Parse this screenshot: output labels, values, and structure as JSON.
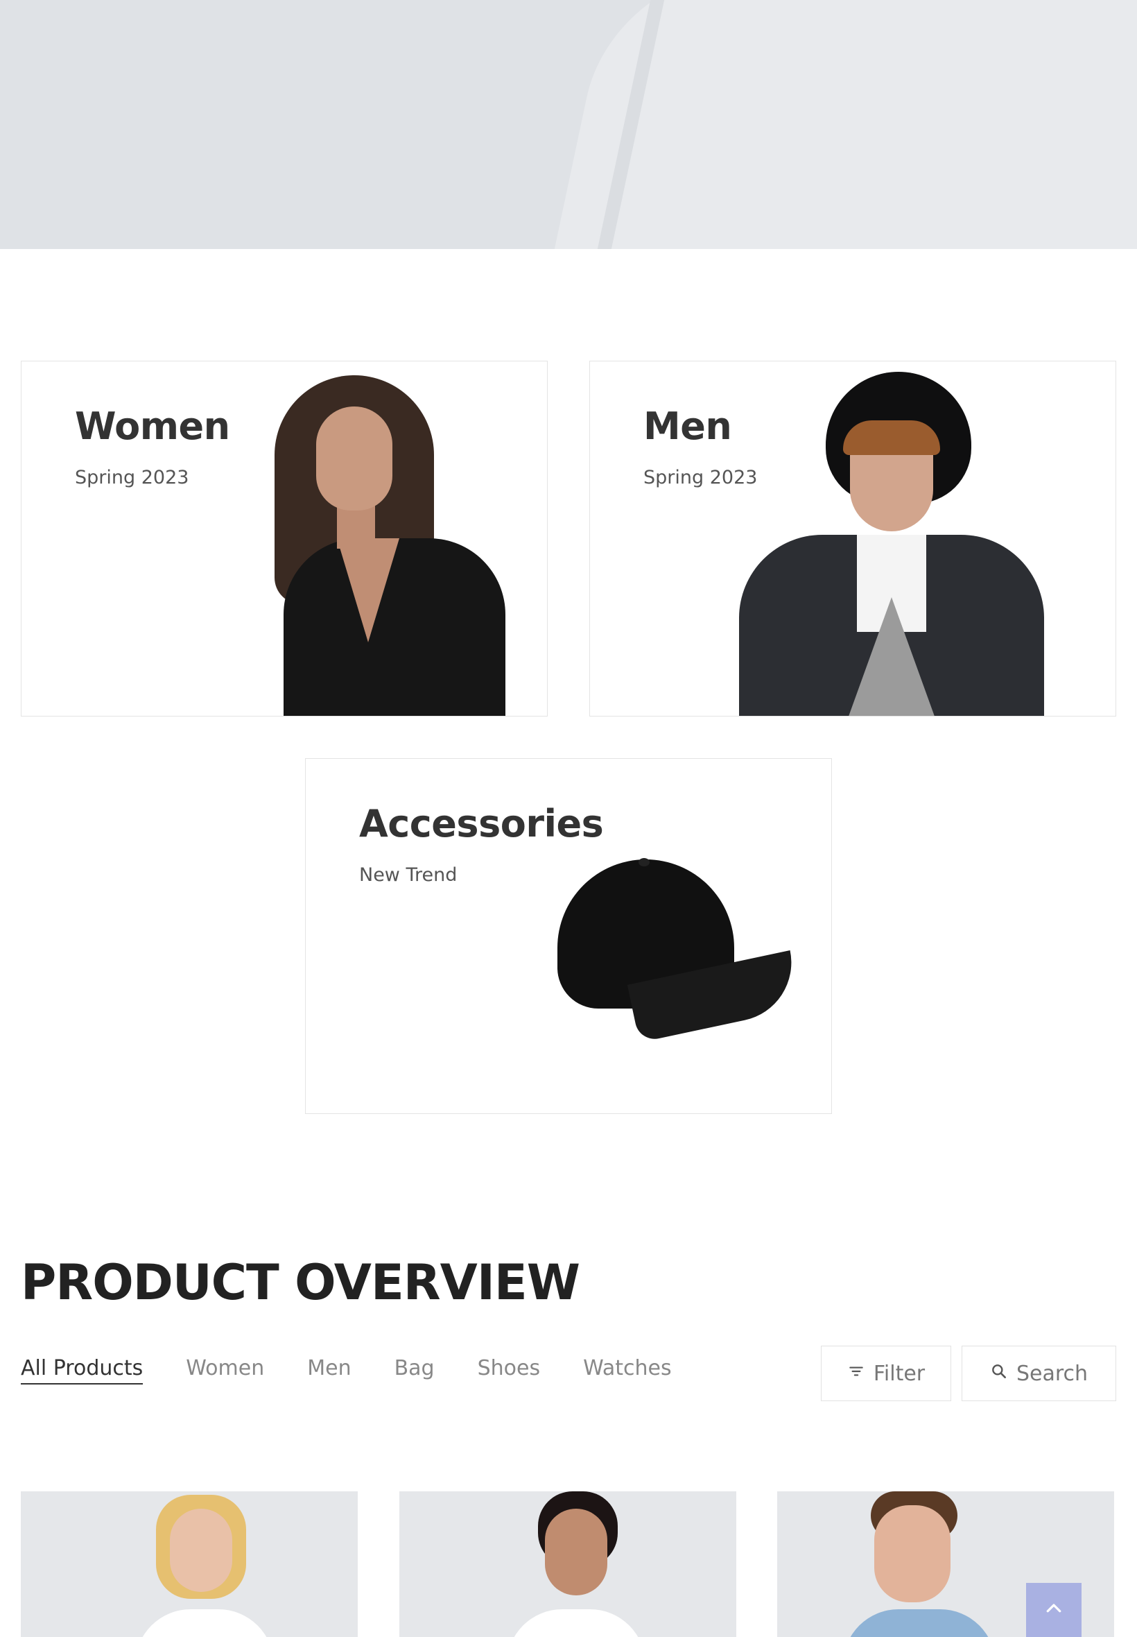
{
  "banners": [
    {
      "title": "Women",
      "subtitle": "Spring 2023"
    },
    {
      "title": "Men",
      "subtitle": "Spring 2023"
    },
    {
      "title": "Accessories",
      "subtitle": "New Trend"
    }
  ],
  "overview": {
    "title": "PRODUCT OVERVIEW",
    "tabs": [
      "All Products",
      "Women",
      "Men",
      "Bag",
      "Shoes",
      "Watches"
    ],
    "active_tab": "All Products",
    "filter_label": "Filter",
    "search_label": "Search"
  },
  "icons": {
    "filter": "filter-icon",
    "search": "search-icon",
    "scroll_top": "chevron-up-icon"
  },
  "colors": {
    "hero_bg": "#dfe2e6",
    "scroll_top_bg": "#a9b1e2",
    "card_bg": "#e5e7ea"
  }
}
